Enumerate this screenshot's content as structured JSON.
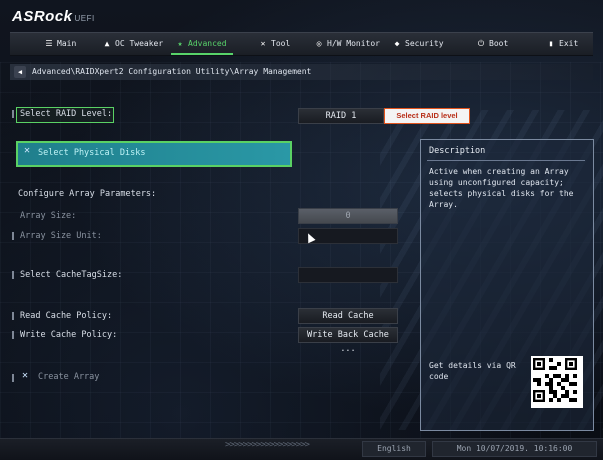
{
  "brand": {
    "name": "ASRock",
    "suffix": "UEFI"
  },
  "menu": {
    "tabs": [
      {
        "label": "Main",
        "icon": "list-icon",
        "glyph": "☰"
      },
      {
        "label": "OC Tweaker",
        "icon": "rocket-icon",
        "glyph": "▲"
      },
      {
        "label": "Advanced",
        "icon": "star-icon",
        "glyph": "★"
      },
      {
        "label": "Tool",
        "icon": "tool-icon",
        "glyph": "✕"
      },
      {
        "label": "H/W Monitor",
        "icon": "monitor-icon",
        "glyph": "◎"
      },
      {
        "label": "Security",
        "icon": "shield-icon",
        "glyph": "◆"
      },
      {
        "label": "Boot",
        "icon": "power-icon",
        "glyph": "⏻"
      },
      {
        "label": "Exit",
        "icon": "exit-icon",
        "glyph": "▮"
      }
    ],
    "active": "Advanced"
  },
  "breadcrumb": "Advanced\\RAIDXpert2 Configuration Utility\\Array Management",
  "settings": {
    "raid_level": {
      "label": "Select RAID Level:",
      "value": "RAID 1",
      "tooltip": "Select RAID level"
    },
    "physical_disks": {
      "label": "Select Physical Disks"
    },
    "section_title": "Configure Array Parameters:",
    "array_size": {
      "label": "Array Size:",
      "value": "0"
    },
    "array_size_unit": {
      "label": "Array Size Unit:",
      "value": ""
    },
    "cache_tag_size": {
      "label": "Select CacheTagSize:",
      "value": ""
    },
    "read_cache": {
      "label": "Read Cache Policy:",
      "value": "Read Cache"
    },
    "write_cache": {
      "label": "Write Cache Policy:",
      "value": "Write Back Cache ..."
    },
    "create_array": {
      "label": "Create Array"
    }
  },
  "description": {
    "title": "Description",
    "body": "Active when creating an Array\nusing unconfigured capacity;\nselects physical disks for the\nArray.",
    "qr_text": "Get details via QR\ncode"
  },
  "footer": {
    "language": "English",
    "datetime": "Mon 10/07/2019. 10:16:00"
  },
  "colors": {
    "accent": "#58d36a",
    "highlight": "#2a98a6"
  }
}
